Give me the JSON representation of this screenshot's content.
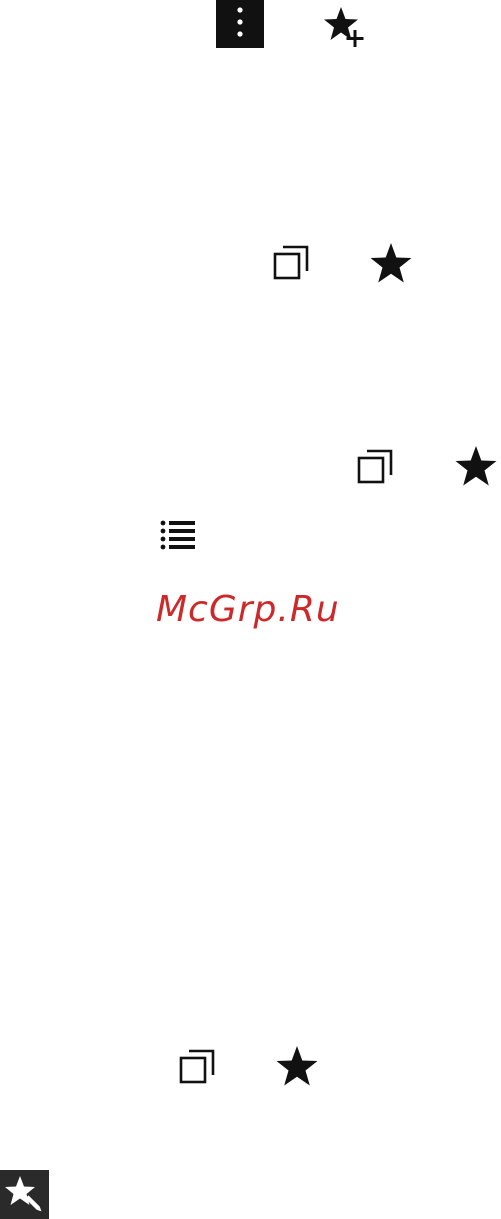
{
  "colors": {
    "icon": "#111111",
    "icon_on_dark": "#ffffff",
    "dark_tile": "#111111",
    "dark_tile_alt": "#2a2a2a",
    "watermark": "#cc2a2a"
  },
  "icons": [
    "more-vertical-icon",
    "star-add-icon",
    "copy-icon",
    "star-icon",
    "copy-icon",
    "star-icon",
    "list-icon",
    "copy-icon",
    "star-icon",
    "star-edit-icon"
  ],
  "watermark": {
    "text": "McGrp.Ru"
  }
}
